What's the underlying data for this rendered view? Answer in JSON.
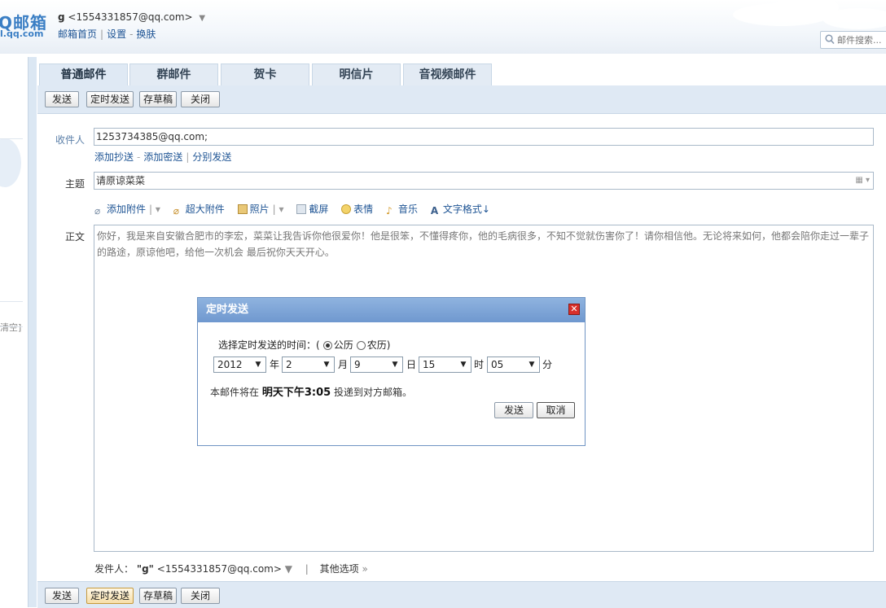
{
  "header": {
    "logo_text": "Q邮箱",
    "logo_domain": "l.qq.com",
    "user_name": "g",
    "user_email": "<1554331857@qq.com>",
    "user_arrow": "▼",
    "links": [
      "邮箱首页",
      "设置",
      "换肤"
    ],
    "search_placeholder": "邮件搜索..."
  },
  "sidebar": {
    "partial_text": "清空]"
  },
  "tabs": [
    {
      "label": "普通邮件"
    },
    {
      "label": "群邮件"
    },
    {
      "label": "贺卡"
    },
    {
      "label": "明信片"
    },
    {
      "label": "音视频邮件"
    }
  ],
  "toolbar": {
    "send": "发送",
    "scheduled_send": "定时发送",
    "save_draft": "存草稿",
    "close": "关闭"
  },
  "compose": {
    "to_label": "收件人",
    "to_value": "1253734385@qq.com;",
    "cc_links": [
      "添加抄送",
      "添加密送",
      "分别发送"
    ],
    "subject_label": "主题",
    "subject_value": "请原谅菜菜",
    "attach_items": [
      "添加附件",
      "超大附件",
      "照片",
      "截屏",
      "表情",
      "音乐",
      "文字格式↓"
    ],
    "body_label": "正文",
    "body_text": "你好，我是来自安徽合肥市的李宏，菜菜让我告诉你他很爱你！他是很笨，不懂得疼你，他的毛病很多，不知不觉就伤害你了！请你相信他。无论将来如何，他都会陪你走过一辈子的路途，原谅他吧，给他一次机会 最后祝你天天开心。",
    "sender_label": "发件人：",
    "sender_name": "\"g\"",
    "sender_email": "<1554331857@qq.com>",
    "sender_arrow": "▼",
    "other_options": "其他选项"
  },
  "dialog": {
    "title": "定时发送",
    "close_symbol": "✕",
    "prompt": "选择定时发送的时间：(",
    "radio_solar": "公历",
    "radio_lunar": "农历)",
    "year": "2012",
    "year_unit": "年",
    "month": "2",
    "month_unit": "月",
    "day": "9",
    "day_unit": "日",
    "hour": "15",
    "hour_unit": "时",
    "minute": "05",
    "minute_unit": "分",
    "info_prefix": "本邮件将在",
    "info_time": "明天下午3:05",
    "info_suffix": "投递到对方邮箱。",
    "send": "发送",
    "cancel": "取消"
  }
}
